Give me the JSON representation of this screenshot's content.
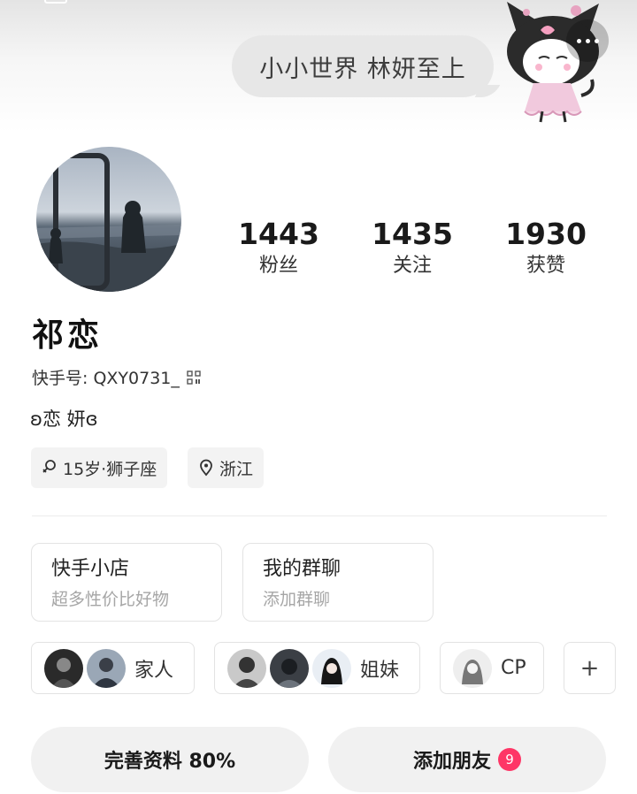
{
  "header": {
    "bubble_text": "小小世界 林妍至上"
  },
  "stats": [
    {
      "value": "1443",
      "label": "粉丝"
    },
    {
      "value": "1435",
      "label": "关注"
    },
    {
      "value": "1930",
      "label": "获赞"
    }
  ],
  "profile": {
    "nickname": "祁恋",
    "kuaishou_id": "快手号: QXY0731_",
    "bio": "ʚ恋 妍ɞ"
  },
  "tags": [
    {
      "text": "15岁·狮子座",
      "icon": "female-icon"
    },
    {
      "text": "浙江",
      "icon": "location-pin-icon"
    }
  ],
  "cards": [
    {
      "title": "快手小店",
      "subtitle": "超多性价比好物"
    },
    {
      "title": "我的群聊",
      "subtitle": "添加群聊"
    }
  ],
  "groups": [
    {
      "label": "家人"
    },
    {
      "label": "姐妹"
    },
    {
      "label": "CP"
    }
  ],
  "add_group_label": "+",
  "actions": {
    "complete_profile": "完善资料 80%",
    "add_friends": "添加朋友",
    "add_friends_badge": "9"
  },
  "colors": {
    "badge": "#fe3666",
    "button_bg": "#f1f1f1",
    "tag_bg": "#f3f3f3"
  }
}
